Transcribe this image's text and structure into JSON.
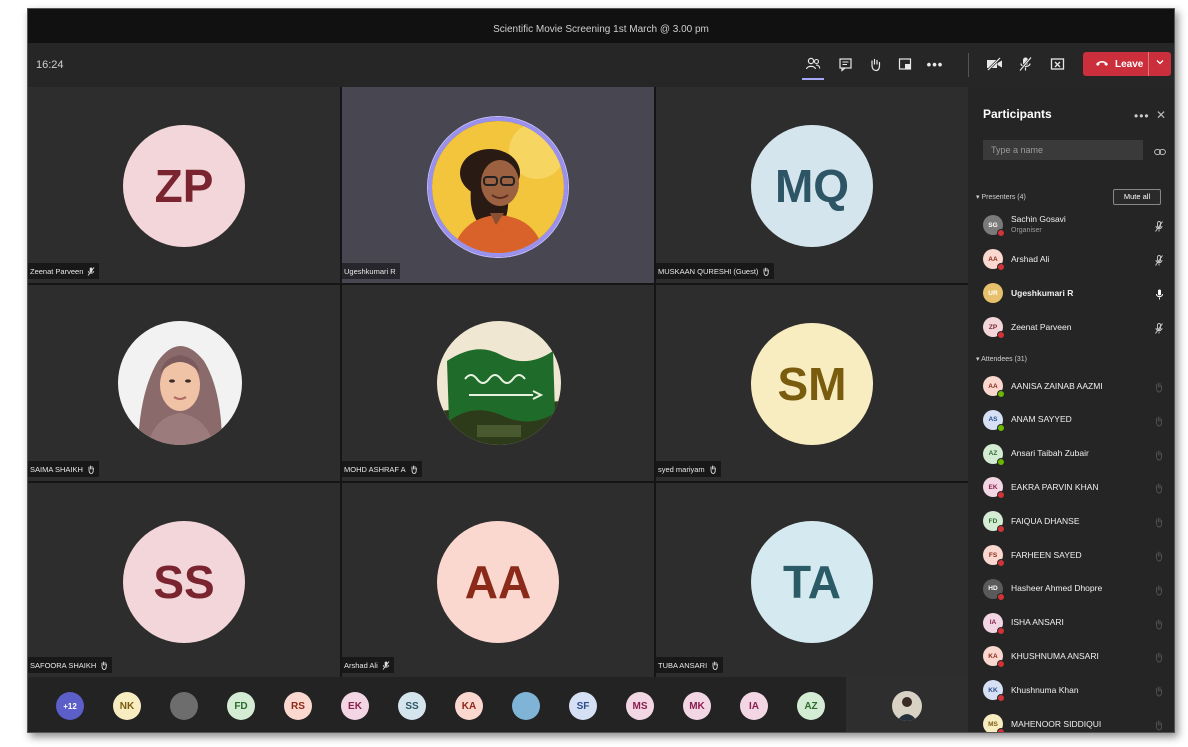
{
  "window": {
    "title": "Scientific Movie Screening 1st March @ 3.00 pm"
  },
  "toolbar": {
    "timer": "16:24",
    "leave_label": "Leave",
    "icons": [
      "participants-icon",
      "chat-icon",
      "raise-hand-icon",
      "rooms-icon",
      "more-icon",
      "camera-off-icon",
      "mic-off-icon",
      "share-tray-icon",
      "phone-icon",
      "chevron-down-icon"
    ]
  },
  "grid": {
    "tiles": [
      {
        "name": "Zeenat Parveen",
        "initials": "ZP",
        "mic": "muted"
      },
      {
        "name": "Ugeshkumari R",
        "initials": "",
        "mic": "speaking"
      },
      {
        "name": "MUSKAAN QURESHI (Guest)",
        "initials": "MQ",
        "mic": "raised"
      },
      {
        "name": "SAIMA SHAIKH",
        "initials": "",
        "mic": "raised"
      },
      {
        "name": "MOHD ASHRAF A",
        "initials": "",
        "mic": "raised"
      },
      {
        "name": "syed mariyam",
        "initials": "SM",
        "mic": "raised"
      },
      {
        "name": "SAFOORA SHAIKH",
        "initials": "SS",
        "mic": "raised"
      },
      {
        "name": "Arshad Ali",
        "initials": "AA",
        "mic": "muted"
      },
      {
        "name": "TUBA ANSARI",
        "initials": "TA",
        "mic": "raised"
      }
    ]
  },
  "strip": {
    "overflow": "+12",
    "chips": [
      {
        "initials": "NK",
        "color": "#f8ecc1",
        "text": "#7a5c0e"
      },
      {
        "initials": "",
        "color": "#6d6d6d",
        "text": "#fff"
      },
      {
        "initials": "FD",
        "color": "#d3ecd3",
        "text": "#2e6b2e"
      },
      {
        "initials": "RS",
        "color": "#fad7cf",
        "text": "#8b2a18"
      },
      {
        "initials": "EK",
        "color": "#f3d6e3",
        "text": "#8b1f4f"
      },
      {
        "initials": "SS",
        "color": "#d5e5ed",
        "text": "#2d5566"
      },
      {
        "initials": "KA",
        "color": "#fad7cf",
        "text": "#8b2a18"
      },
      {
        "initials": "",
        "color": "#7fb4d6",
        "text": "#fff"
      },
      {
        "initials": "SF",
        "color": "#d5e0f5",
        "text": "#2c4e8c"
      },
      {
        "initials": "MS",
        "color": "#f3d6e3",
        "text": "#8b1f4f"
      },
      {
        "initials": "MK",
        "color": "#f3d6e3",
        "text": "#8b1f4f"
      },
      {
        "initials": "IA",
        "color": "#f3d6e3",
        "text": "#8b1f4f"
      },
      {
        "initials": "AZ",
        "color": "#d3ecd3",
        "text": "#2e6b2e"
      }
    ]
  },
  "participants": {
    "title": "Participants",
    "search_placeholder": "Type a name",
    "presenters_label": "Presenters (4)",
    "mute_all_label": "Mute all",
    "attendees_label": "Attendees (31)",
    "presenters": [
      {
        "name": "Sachin Gosavi",
        "role": "Organiser",
        "initials": "SG",
        "color": "#7a7a7a",
        "text": "#fff",
        "status": "red",
        "mic": "muted"
      },
      {
        "name": "Arshad Ali",
        "role": "",
        "initials": "AA",
        "color": "#fad7cf",
        "text": "#8b2a18",
        "status": "red",
        "mic": "muted"
      },
      {
        "name": "Ugeshkumari R",
        "role": "",
        "initials": "UR",
        "color": "#e6c06a",
        "text": "#fff",
        "status": "",
        "mic": "on"
      },
      {
        "name": "Zeenat Parveen",
        "role": "",
        "initials": "ZP",
        "color": "#f3d6d9",
        "text": "#7a2430",
        "status": "red",
        "mic": "muted"
      }
    ],
    "attendees": [
      {
        "name": "AANISA ZAINAB AAZMI",
        "initials": "AA",
        "color": "#fad7cf",
        "text": "#8b2a18",
        "status": "green"
      },
      {
        "name": "ANAM SAYYED",
        "initials": "AS",
        "color": "#d5e0f5",
        "text": "#2c4e8c",
        "status": "green"
      },
      {
        "name": "Ansari Taibah Zubair",
        "initials": "AZ",
        "color": "#d3ecd3",
        "text": "#2e6b2e",
        "status": "green"
      },
      {
        "name": "EAKRA PARVIN KHAN",
        "initials": "EK",
        "color": "#f3d6e3",
        "text": "#8b1f4f",
        "status": "red"
      },
      {
        "name": "FAIQUA DHANSE",
        "initials": "FD",
        "color": "#d3ecd3",
        "text": "#2e6b2e",
        "status": "red"
      },
      {
        "name": "FARHEEN SAYED",
        "initials": "FS",
        "color": "#fad7cf",
        "text": "#8b2a18",
        "status": "red"
      },
      {
        "name": "Hasheer Ahmed Dhopre",
        "initials": "HD",
        "color": "#5a5a5a",
        "text": "#fff",
        "status": "red"
      },
      {
        "name": "ISHA ANSARI",
        "initials": "IA",
        "color": "#f3d6e3",
        "text": "#8b1f4f",
        "status": "red"
      },
      {
        "name": "KHUSHNUMA ANSARI",
        "initials": "KA",
        "color": "#fad7cf",
        "text": "#8b2a18",
        "status": "red"
      },
      {
        "name": "Khushnuma Khan",
        "initials": "KK",
        "color": "#d5e0f5",
        "text": "#2c4e8c",
        "status": "red"
      },
      {
        "name": "MAHENOOR SIDDIQUI",
        "initials": "MS",
        "color": "#f8ecc1",
        "text": "#7a5c0e",
        "status": "red"
      }
    ]
  }
}
